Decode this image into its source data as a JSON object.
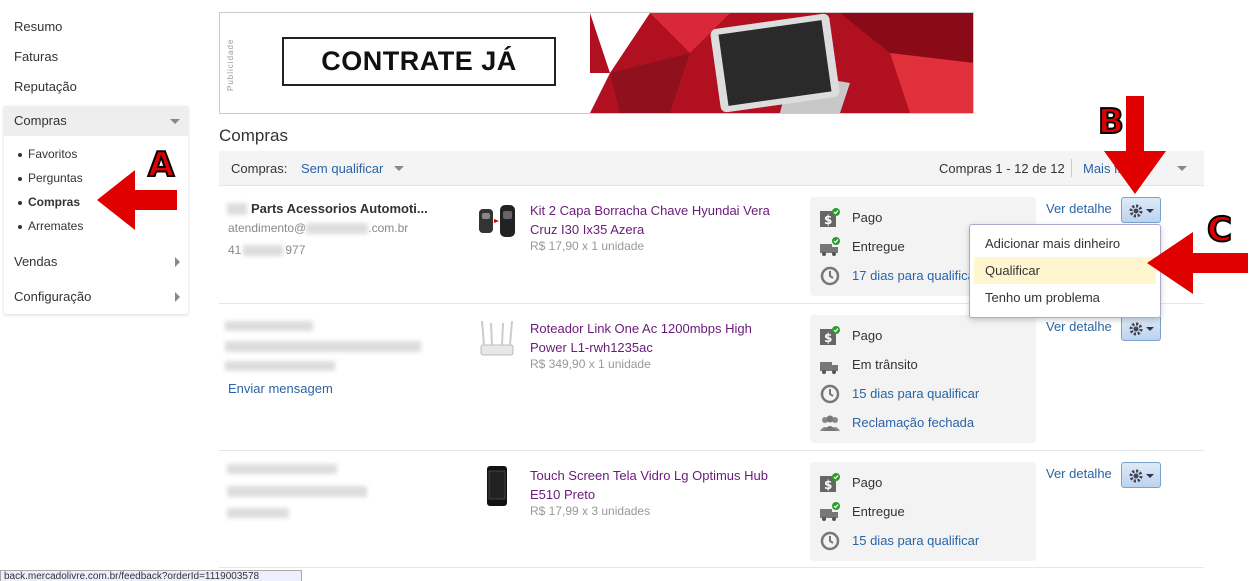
{
  "sidebar": {
    "links": [
      "Resumo",
      "Faturas",
      "Reputação"
    ],
    "group_title": "Compras",
    "sub_items": [
      "Favoritos",
      "Perguntas",
      "Compras",
      "Arremates"
    ],
    "active_sub": "Compras",
    "rows": [
      "Vendas",
      "Configuração"
    ]
  },
  "ad": {
    "side_label": "Publicidade",
    "cta": "CONTRATE JÁ"
  },
  "page_title": "Compras",
  "filter": {
    "label": "Compras:",
    "value": "Sem qualificar",
    "count": "Compras 1 - 12 de 12",
    "more": "Mais filtros"
  },
  "purchases": [
    {
      "seller_name": "Parts Acessorios Automoti...",
      "seller_email_start": "atendimento@",
      "seller_email_end": ".com.br",
      "seller_phone_start": "41",
      "seller_phone_end": "977",
      "product_title": "Kit 2 Capa Borracha Chave Hyundai Vera Cruz I30 Ix35 Azera",
      "price": "R$ 17,90 x 1 unidade",
      "statuses": [
        {
          "icon": "dollar-check-icon",
          "text": "Pago",
          "link": false
        },
        {
          "icon": "truck-check-icon",
          "text": "Entregue",
          "link": false
        },
        {
          "icon": "clock-icon",
          "text": "17 dias para qualificar",
          "link": true
        }
      ],
      "detail": "Ver detalhe"
    },
    {
      "message_link": "Enviar mensagem",
      "product_title": "Roteador Link One Ac 1200mbps High Power L1-rwh1235ac",
      "price": "R$ 349,90 x 1 unidade",
      "statuses": [
        {
          "icon": "dollar-check-icon",
          "text": "Pago",
          "link": false
        },
        {
          "icon": "truck-icon",
          "text": "Em trânsito",
          "link": false
        },
        {
          "icon": "clock-icon",
          "text": "15 dias para qualificar",
          "link": true
        },
        {
          "icon": "people-icon",
          "text": "Reclamação fechada",
          "link": true
        }
      ],
      "detail": "Ver detalhe"
    },
    {
      "product_title": "Touch Screen Tela Vidro Lg Optimus Hub E510 Preto",
      "price": "R$ 17,99 x 3 unidades",
      "statuses": [
        {
          "icon": "dollar-check-icon",
          "text": "Pago",
          "link": false
        },
        {
          "icon": "truck-check-icon",
          "text": "Entregue",
          "link": false
        },
        {
          "icon": "clock-icon",
          "text": "15 dias para qualificar",
          "link": true
        }
      ],
      "detail": "Ver detalhe"
    }
  ],
  "dropdown": {
    "items": [
      "Adicionar mais dinheiro",
      "Qualificar",
      "Tenho um problema"
    ],
    "highlighted": "Qualificar"
  },
  "annotations": {
    "a": "A",
    "b": "B",
    "c": "C",
    "color": "#e00000"
  },
  "status_url": "back.mercadolivre.com.br/feedback?orderId=1119003578"
}
